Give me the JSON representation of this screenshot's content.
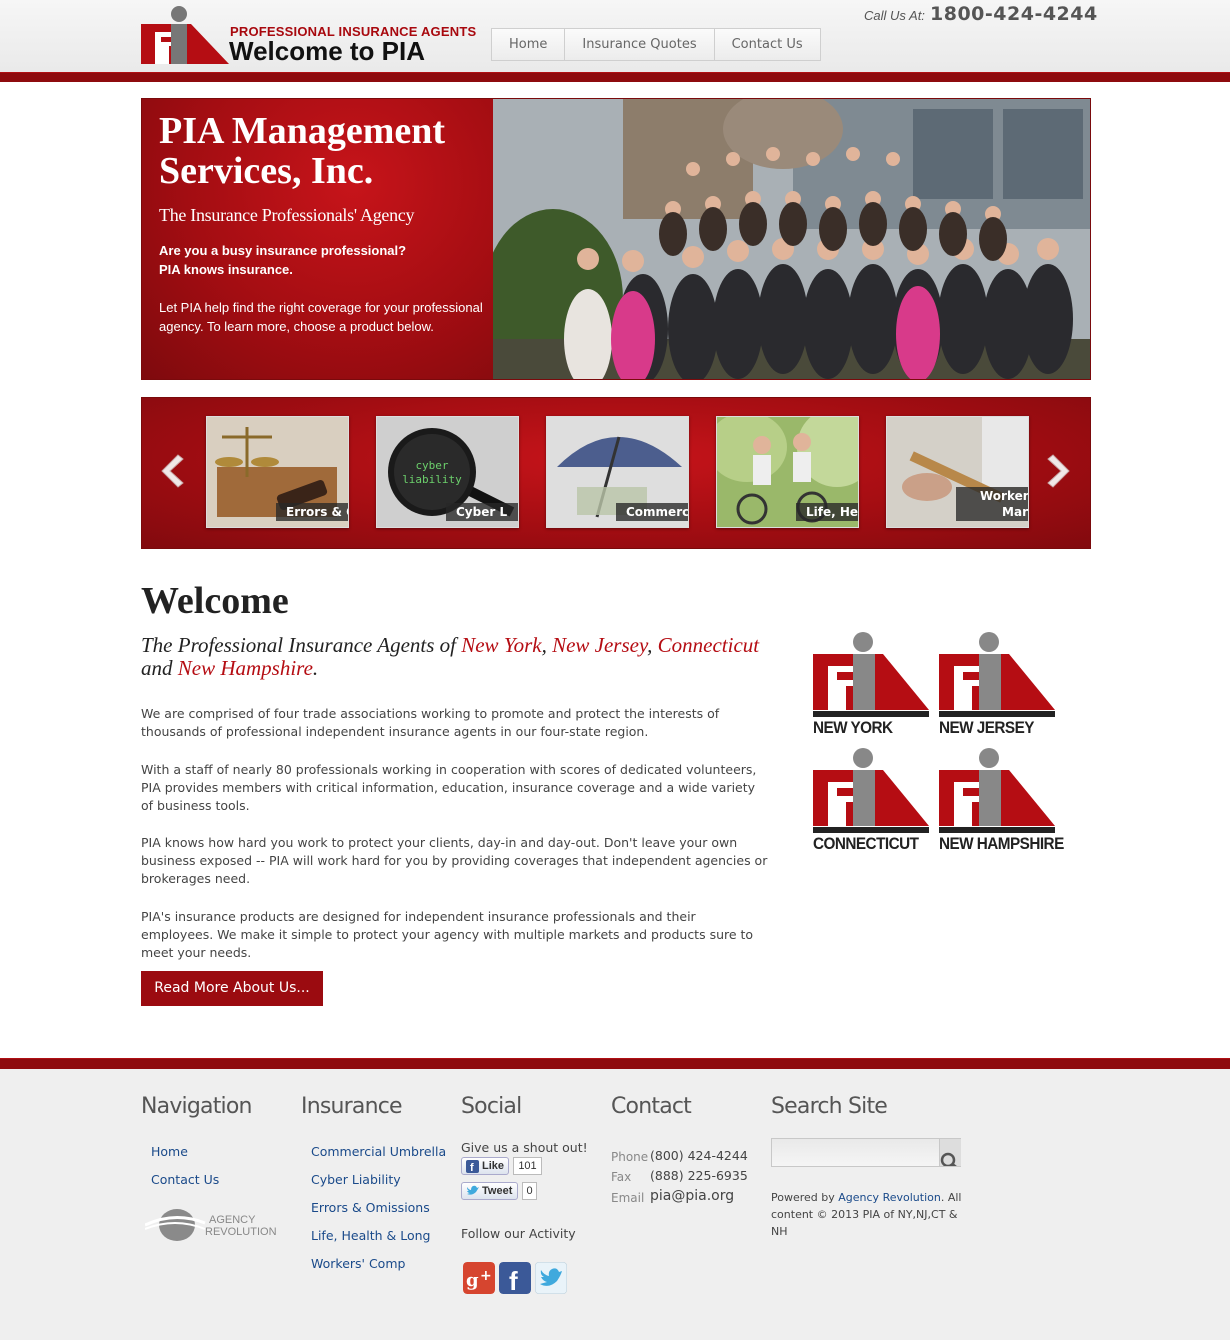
{
  "header": {
    "logo_subtitle": "PROFESSIONAL INSURANCE AGENTS",
    "logo_title": "Welcome to PIA",
    "call_label": "Call Us At:",
    "phone": "1800-424-4244",
    "nav": [
      "Home",
      "Insurance Quotes",
      "Contact Us"
    ]
  },
  "hero": {
    "title": "PIA Management Services, Inc.",
    "tagline": "The Insurance Professionals' Agency",
    "question_line1": "Are you a busy insurance professional?",
    "question_line2": "PIA knows insurance.",
    "body": "Let PIA help find the right coverage for your professional agency. To learn more, choose a product below."
  },
  "carousel": {
    "items": [
      {
        "label": "Errors & O"
      },
      {
        "label": "Cyber L"
      },
      {
        "label": "Commercia"
      },
      {
        "label": "Life, Heal"
      },
      {
        "label_line1": "Workers",
        "label_line2": "Mar"
      }
    ],
    "cyber_text_1": "cyber",
    "cyber_text_2": "liability"
  },
  "welcome": {
    "title": "Welcome",
    "sub_prefix": "The Professional Insurance Agents of ",
    "state1": "New York",
    "state2": "New Jersey",
    "state3": "Connecticut",
    "sub_and": " and ",
    "state4": "New Hampshire",
    "paragraphs": [
      "We are comprised of four trade associations working to promote and protect the interests of thousands of professional independent insurance agents in our four-state region.",
      "With a staff of nearly 80 professionals working in cooperation with scores of dedicated volunteers, PIA provides members with critical information, education, insurance coverage and a wide variety of business tools.",
      "PIA knows how hard you work to protect your clients, day-in and day-out.  Don't leave your own business exposed -- PIA will work hard for you by providing coverages that independent agencies or brokerages need.",
      "PIA's insurance products are designed for independent insurance professionals and their employees.  We make it simple to protect your agency with multiple markets and products sure to meet your needs."
    ],
    "read_more": "Read More About Us..."
  },
  "state_logos": [
    "NEW YORK",
    "NEW JERSEY",
    "CONNECTICUT",
    "NEW HAMPSHIRE"
  ],
  "footer": {
    "navigation": {
      "heading": "Navigation",
      "links": [
        "Home",
        "Contact Us"
      ],
      "agency_logo_line1": "AGENCY",
      "agency_logo_line2": "REVOLUTION"
    },
    "insurance": {
      "heading": "Insurance",
      "links": [
        "Commercial Umbrella",
        "Cyber Liability",
        "Errors & Omissions",
        "Life, Health & Long",
        "Workers' Comp"
      ]
    },
    "social": {
      "heading": "Social",
      "shout": "Give us a shout out!",
      "like": "Like",
      "like_count": "101",
      "tweet": "Tweet",
      "tweet_count": "0",
      "follow": "Follow our Activity"
    },
    "contact": {
      "heading": "Contact",
      "phone_label": "Phone",
      "phone": "(800) 424-4244",
      "fax_label": "Fax",
      "fax": "(888) 225-6935",
      "email_label": "Email",
      "email": "pia@pia.org"
    },
    "search": {
      "heading": "Search Site",
      "placeholder": "",
      "powered_prefix": "Powered by ",
      "powered_link": "Agency Revolution",
      "powered_suffix": ". All content © 2013 PIA of NY,NJ,CT & NH"
    }
  },
  "colors": {
    "brand_red": "#9b0b10",
    "link_blue": "#1a4a8a",
    "highlight_red": "#b50d13"
  }
}
